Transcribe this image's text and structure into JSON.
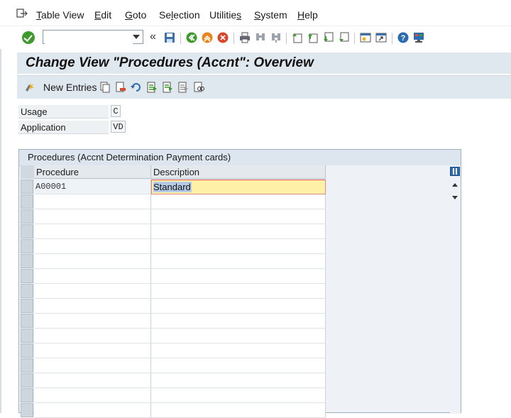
{
  "menu": {
    "items": [
      {
        "id": "table-view",
        "pre": "",
        "ul": "T",
        "post": "able View"
      },
      {
        "id": "edit",
        "pre": "",
        "ul": "E",
        "post": "dit"
      },
      {
        "id": "goto",
        "pre": "",
        "ul": "G",
        "post": "oto"
      },
      {
        "id": "selection",
        "pre": "Se",
        "ul": "l",
        "post": "ection"
      },
      {
        "id": "utilities",
        "pre": "Utilitie",
        "ul": "s",
        "post": ""
      },
      {
        "id": "system",
        "pre": "",
        "ul": "S",
        "post": "ystem"
      },
      {
        "id": "help",
        "pre": "",
        "ul": "H",
        "post": "elp"
      }
    ]
  },
  "toolbar": {
    "command_value": "",
    "chevron": "«"
  },
  "title": "Change View \"Procedures (Accnt\": Overview",
  "app_toolbar": {
    "new_entries_label": "New Entries"
  },
  "fields": {
    "usage_label": "Usage",
    "usage_value": "C",
    "application_label": "Application",
    "application_value": "VD"
  },
  "table": {
    "title": "Procedures (Accnt Determination Payment cards)",
    "columns": [
      "Procedure",
      "Description"
    ],
    "rows": [
      {
        "procedure": "A00001",
        "description": "Standard"
      }
    ],
    "empty_rows": 15
  },
  "colors": {
    "accent_bar": "#dfe7ef",
    "focus_field": "#fff0a8",
    "ok_green": "#3e9a2c"
  }
}
